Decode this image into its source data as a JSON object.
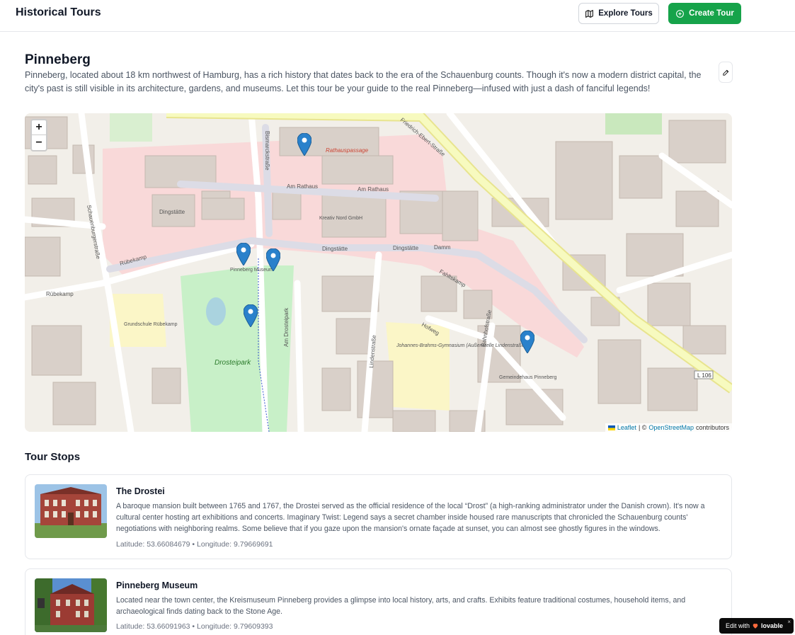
{
  "header": {
    "brand": "Historical Tours",
    "explore_label": "Explore Tours",
    "create_label": "Create Tour"
  },
  "tour": {
    "title": "Pinneberg",
    "description": "Pinneberg, located about 18 km northwest of Hamburg, has a rich history that dates back to the era of the Schauenburg counts. Though it's now a modern district capital, the city's past is still visible in its architecture, gardens, and museums. Let this tour be your guide to the real Pinneberg—infused with just a dash of fanciful legends!"
  },
  "map": {
    "zoom_in": "+",
    "zoom_out": "−",
    "attribution_leaflet": "Leaflet",
    "attribution_sep": "| ©",
    "attribution_osm": "OpenStreetMap",
    "attribution_suffix": "contributors",
    "labels": {
      "rathauspassage": "Rathauspassage",
      "am_rathaus": "Am Rathaus",
      "dingstaette": "Dingstätte",
      "damm": "Damm",
      "rubekamp": "Rübekamp",
      "drosteipark": "Drosteipark",
      "fahltskamp": "Fahltskamp",
      "friedrich_ebert": "Friedrich-Ebert-Straße",
      "bismarckstrasse": "Bismarckstraße",
      "schauenburgerstrasse": "Schauenburgerstraße",
      "pinneberg_museum": "Pinneberg Museum",
      "kreativ": "Kreativ Nord GmbH",
      "gymnasium": "Johannes-Brahms-Gymnasium (Außenstelle Lindenstraße)",
      "grundschule": "Grundschule Rübekamp",
      "gemeindehaus": "Gemeindehaus Pinneberg",
      "l106": "L 106",
      "bahnhofstrasse": "Bahnhofstraße",
      "am_drosteipark": "Am Drosteipark",
      "lindenstrasse": "Lindenstraße",
      "hofweg": "Hofweg"
    }
  },
  "stops_section": {
    "title": "Tour Stops"
  },
  "stops": [
    {
      "title": "The Drostei",
      "description": "A baroque mansion built between 1765 and 1767, the Drostei served as the official residence of the local “Drost” (a high-ranking administrator under the Danish crown). It's now a cultural center hosting art exhibitions and concerts. Imaginary Twist: Legend says a secret chamber inside housed rare manuscripts that chronicled the Schauenburg counts' negotiations with neighboring realms. Some believe that if you gaze upon the mansion's ornate façade at sunset, you can almost see ghostly figures in the windows.",
      "coords": "Latitude: 53.66084679  •  Longitude: 9.79669691"
    },
    {
      "title": "Pinneberg Museum",
      "description": "Located near the town center, the Kreismuseum Pinneberg provides a glimpse into local history, arts, and crafts. Exhibits feature traditional costumes, household items, and archaeological finds dating back to the Stone Age.",
      "coords": "Latitude: 53.66091963  •  Longitude: 9.79609393"
    }
  ],
  "badge": {
    "prefix": "Edit with",
    "brand": "lovable",
    "close": "×"
  },
  "colors": {
    "primary": "#16a34a",
    "marker": "#2a81cb",
    "pedestrian": "#f9d4d4",
    "park": "#c8f0c8",
    "building": "#d9d0c9",
    "road_major": "#f7fabf"
  },
  "icons": [
    "map-icon",
    "plus-circle-icon",
    "edit-icon",
    "map-marker-icon",
    "heart-icon"
  ]
}
